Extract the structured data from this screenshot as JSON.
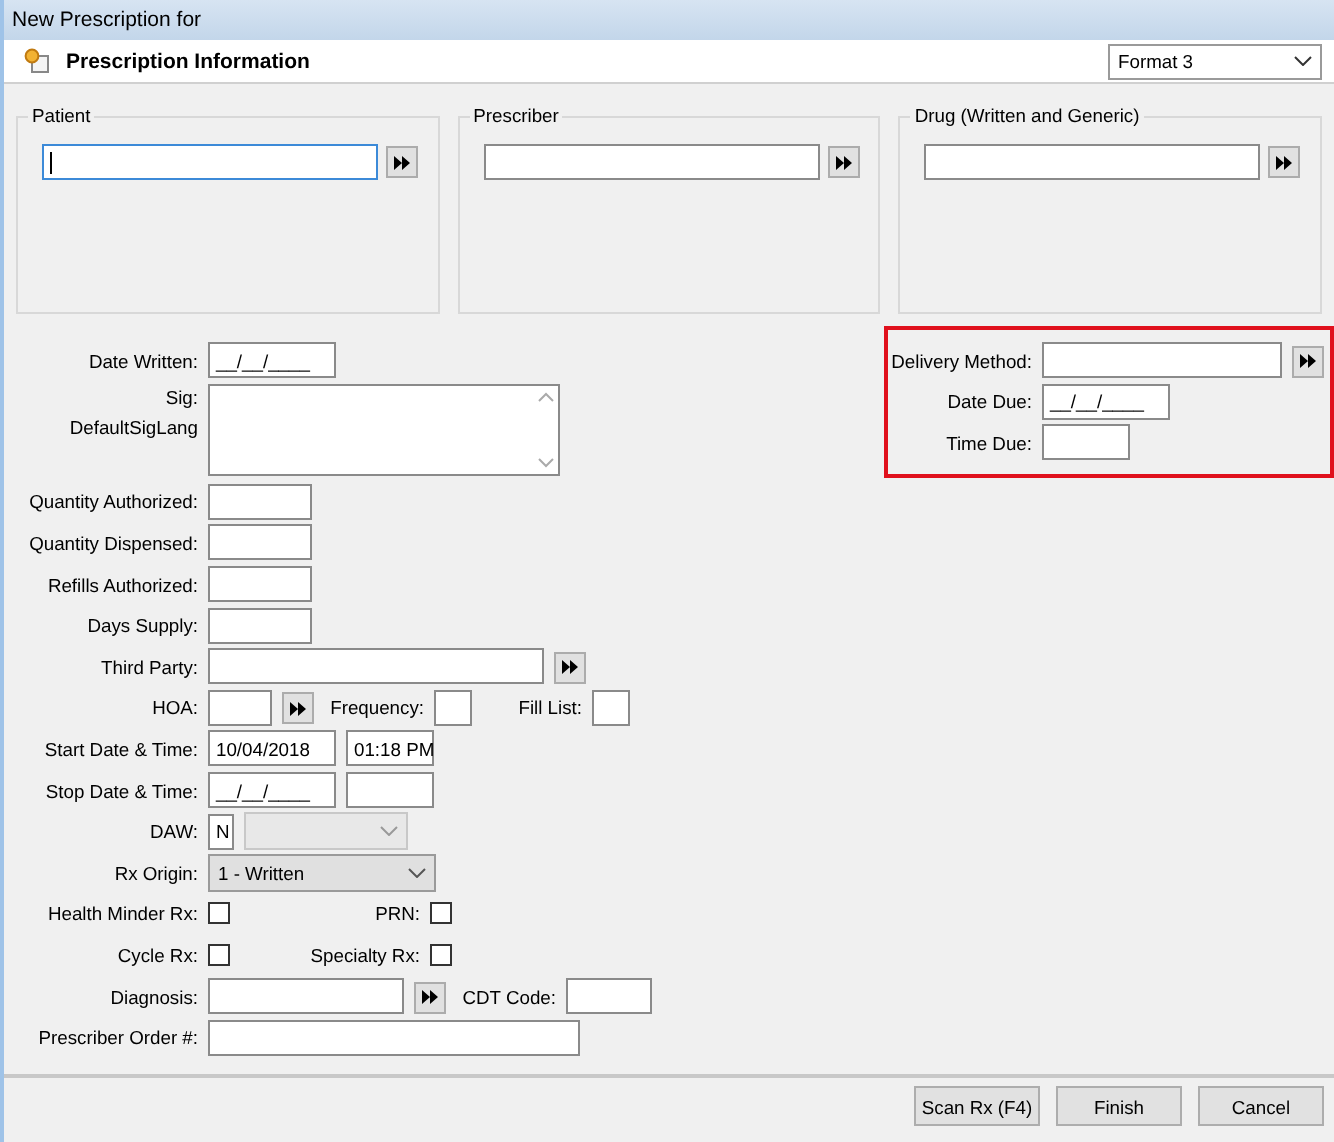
{
  "window": {
    "title": "New Prescription for"
  },
  "header": {
    "title": "Prescription Information",
    "format": "Format 3"
  },
  "groups": [
    {
      "label": "Patient",
      "focused": true
    },
    {
      "label": "Prescriber",
      "focused": false
    },
    {
      "label": "Drug (Written and Generic)",
      "focused": false
    }
  ],
  "form_rows": [
    {
      "label": "Date Written:",
      "controls": [
        {
          "kind": "text",
          "value": "__/__/____"
        }
      ]
    },
    {
      "label": "Sig:",
      "sublabel": "DefaultSigLang",
      "controls": [
        {
          "kind": "textarea"
        }
      ]
    },
    {
      "label": "Quantity Authorized:",
      "controls": [
        {
          "kind": "text"
        }
      ]
    },
    {
      "label": "Quantity Dispensed:",
      "controls": [
        {
          "kind": "text"
        }
      ]
    },
    {
      "label": "Refills Authorized:",
      "controls": [
        {
          "kind": "text"
        }
      ]
    },
    {
      "label": "Days Supply:",
      "controls": [
        {
          "kind": "text"
        }
      ]
    },
    {
      "label": "Third Party:",
      "controls": [
        {
          "kind": "lookup"
        }
      ]
    },
    {
      "label": "HOA:",
      "controls": [
        {
          "kind": "lookup"
        },
        {
          "kind": "label",
          "text": "Frequency:"
        },
        {
          "kind": "text"
        },
        {
          "kind": "label",
          "text": "Fill List:"
        },
        {
          "kind": "text"
        }
      ]
    },
    {
      "label": "Start Date & Time:",
      "controls": [
        {
          "kind": "text",
          "value": "10/04/2018"
        },
        {
          "kind": "text",
          "value": "01:18 PM"
        }
      ]
    },
    {
      "label": "Stop Date & Time:",
      "controls": [
        {
          "kind": "text",
          "value": "__/__/____"
        },
        {
          "kind": "text"
        }
      ]
    },
    {
      "label": "DAW:",
      "controls": [
        {
          "kind": "text",
          "value": "N"
        },
        {
          "kind": "combo",
          "disabled": true
        }
      ]
    },
    {
      "label": "Rx Origin:",
      "controls": [
        {
          "kind": "combo",
          "value": "1 - Written",
          "disabled": false
        }
      ]
    },
    {
      "label": "Health Minder Rx:",
      "controls": [
        {
          "kind": "check",
          "checked": false
        },
        {
          "kind": "label",
          "text": "PRN:"
        },
        {
          "kind": "check",
          "checked": false
        }
      ]
    },
    {
      "label": "Cycle Rx:",
      "controls": [
        {
          "kind": "check",
          "checked": false
        },
        {
          "kind": "label",
          "text": "Specialty Rx:"
        },
        {
          "kind": "check",
          "checked": false
        }
      ]
    },
    {
      "label": "Diagnosis:",
      "controls": [
        {
          "kind": "lookup"
        },
        {
          "kind": "label",
          "text": "CDT Code:"
        },
        {
          "kind": "text"
        }
      ]
    },
    {
      "label": "Prescriber Order #:",
      "controls": [
        {
          "kind": "text"
        }
      ]
    }
  ],
  "delivery": {
    "highlighted": true,
    "rows": [
      {
        "label": "Delivery Method:",
        "controls": [
          {
            "kind": "lookup"
          }
        ]
      },
      {
        "label": "Date Due:",
        "controls": [
          {
            "kind": "text",
            "value": "__/__/____"
          }
        ]
      },
      {
        "label": "Time Due:",
        "controls": [
          {
            "kind": "text"
          }
        ]
      }
    ]
  },
  "buttons": [
    "Scan Rx (F4)",
    "Finish",
    "Cancel"
  ]
}
